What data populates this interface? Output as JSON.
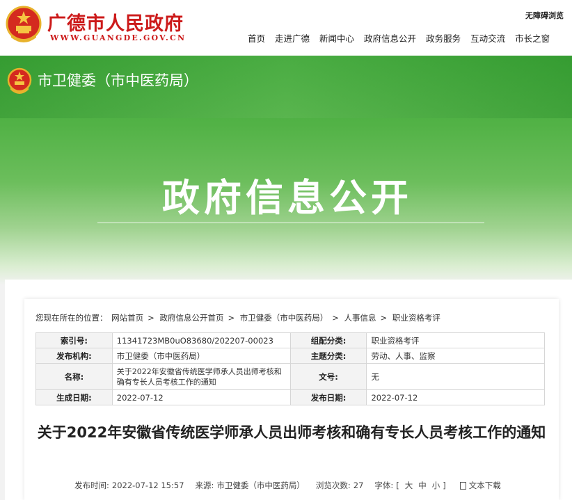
{
  "header": {
    "site_title": "广德市人民政府",
    "site_url": "WWW.GUANGDE.GOV.CN",
    "accessibility": "无障碍浏览",
    "nav": [
      "首页",
      "走进广德",
      "新闻中心",
      "政府信息公开",
      "政务服务",
      "互动交流",
      "市长之窗"
    ]
  },
  "banner": {
    "dept_name": "市卫健委（市中医药局）",
    "title": "政府信息公开"
  },
  "breadcrumb": {
    "prefix": "您现在所在的位置：",
    "items": [
      "网站首页",
      "政府信息公开首页",
      "市卫健委（市中医药局）",
      "人事信息",
      "职业资格考评"
    ]
  },
  "info_table": {
    "index_label": "索引号:",
    "index_value": "11341723MB0uO83680/202207-00023",
    "category_label": "组配分类:",
    "category_value": "职业资格考评",
    "publisher_label": "发布机构:",
    "publisher_value": "市卫健委（市中医药局）",
    "topic_label": "主题分类:",
    "topic_value": "劳动、人事、监察",
    "name_label": "名称:",
    "name_value": "关于2022年安徽省传统医学师承人员出师考核和确有专长人员考核工作的通知",
    "docno_label": "文号:",
    "docno_value": "无",
    "created_label": "生成日期:",
    "created_value": "2022-07-12",
    "published_label": "发布日期:",
    "published_value": "2022-07-12"
  },
  "article": {
    "title": "关于2022年安徽省传统医学师承人员出师考核和确有专长人员考核工作的通知",
    "time_label": "发布时间:",
    "time_value": "2022-07-12 15:57",
    "source_label": "来源:",
    "source_value": "市卫健委（市中医药局）",
    "views_label": "浏览次数:",
    "views_value": "27",
    "font_label": "字体:",
    "font_open": "[",
    "font_large": "大",
    "font_medium": "中",
    "font_small": "小",
    "font_close": "]",
    "download": "文本下载"
  },
  "colors": {
    "brand_red": "#cc1a1a",
    "banner_green": "#52b246"
  }
}
